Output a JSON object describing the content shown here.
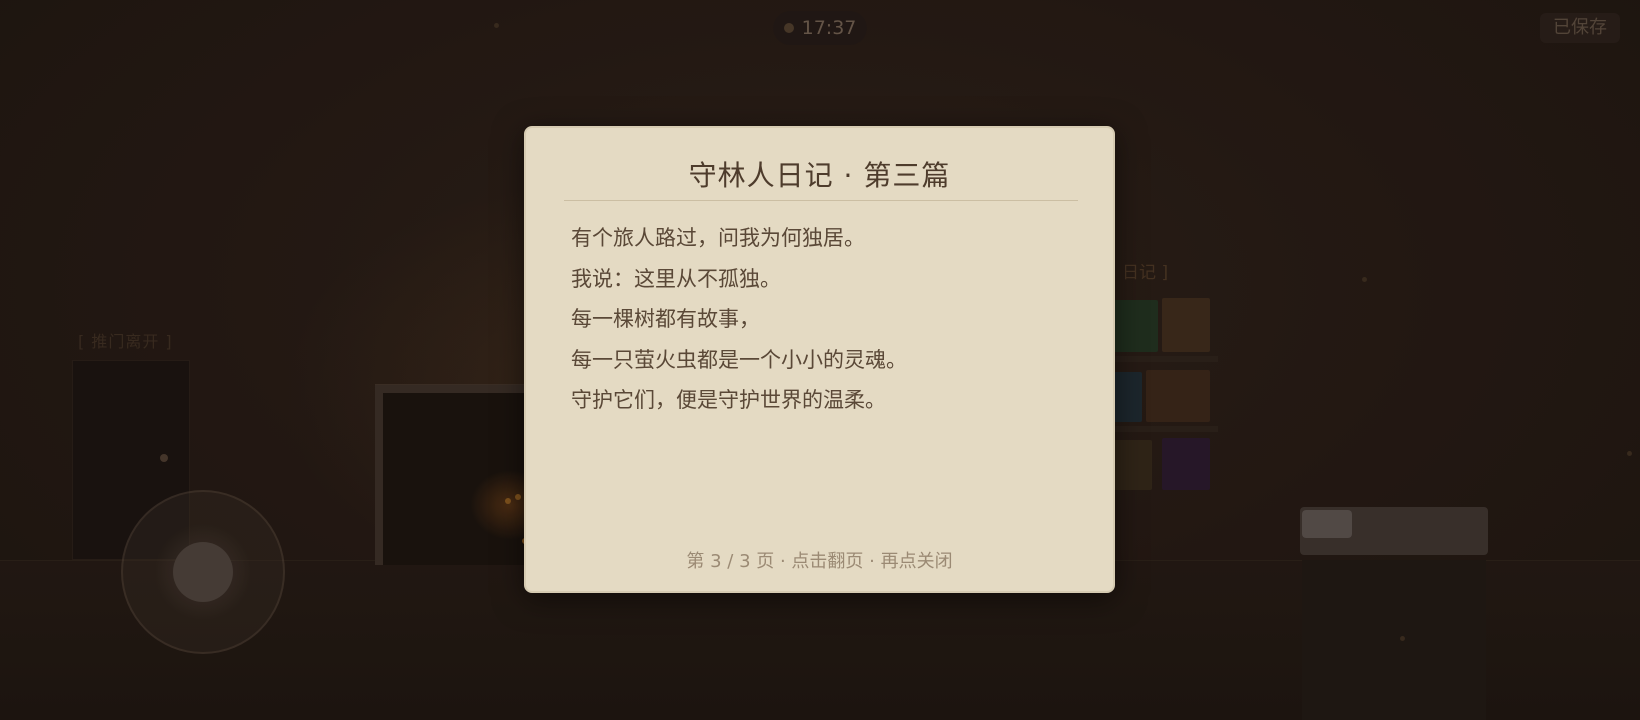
{
  "hud": {
    "clock": "17:37",
    "save_status": "已保存"
  },
  "scene": {
    "door_label": "[ 推门离开 ]",
    "diary_label": "[ 日记 ]"
  },
  "diary_dialog": {
    "title": "守林人日记 · 第三篇",
    "lines": [
      "有个旅人路过，问我为何独居。",
      "我说：这里从不孤独。",
      "每一棵树都有故事，",
      "每一只萤火虫都是一个小小的灵魂。",
      "守护它们，便是守护世界的温柔。"
    ],
    "footer": "第 3 / 3 页 · 点击翻页 · 再点关闭",
    "page_current": 3,
    "page_total": 3
  },
  "colors": {
    "dialog_bg": "#e4dac3",
    "dialog_text": "#5a4837",
    "scene_bg": "#231913"
  },
  "icons": {
    "clock": "status-dot-icon",
    "joystick": "virtual-joystick"
  }
}
